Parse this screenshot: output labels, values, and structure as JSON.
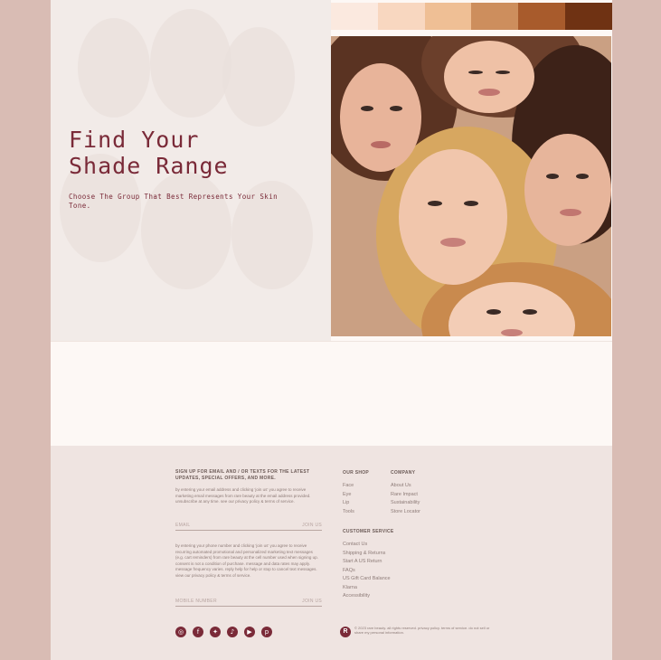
{
  "hero": {
    "title_line1": "Find Your",
    "title_line2": "Shade Range",
    "subtitle": "Choose The Group That Best Represents Your Skin Tone."
  },
  "swatches": [
    "#fbe9df",
    "#f8d7c0",
    "#efbf95",
    "#cd8e5d",
    "#a85b2c",
    "#6f3213"
  ],
  "footer": {
    "signup_heading": "SIGN UP FOR EMAIL AND / OR TEXTS FOR THE LATEST UPDATES, SPECIAL OFFERS, AND MORE.",
    "email_disclaimer": "by entering your email address and clicking 'join us' you agree to receive marketing email messages from rare beauty at the email address provided. unsubscribe at any time. see our privacy policy & terms of service.",
    "email_placeholder": "EMAIL",
    "email_join": "JOIN US",
    "sms_disclaimer": "by entering your phone number and clicking 'join us' you agree to receive recurring automated promotional and personalized marketing text messages (e.g. cart reminders) from rare beauty at the cell number used when signing up. consent is not a condition of purchase. message and data rates may apply. message frequency varies. reply help for help or stop to cancel text messages. view our privacy policy & terms of service.",
    "sms_placeholder": "MOBILE NUMBER",
    "sms_join": "JOIN US",
    "shop_heading": "OUR SHOP",
    "shop_links": [
      "Face",
      "Eye",
      "Lip",
      "Tools"
    ],
    "company_heading": "COMPANY",
    "company_links": [
      "About Us",
      "Rare Impact",
      "Sustainability",
      "Store Locator"
    ],
    "service_heading": "CUSTOMER SERVICE",
    "service_links": [
      "Contact Us",
      "Shipping & Returns",
      "Start A US Return",
      "FAQs",
      "US Gift Card Balance",
      "Klarna",
      "Accessibility"
    ],
    "social_icons": [
      "instagram-icon",
      "facebook-icon",
      "twitter-icon",
      "tiktok-icon",
      "youtube-icon",
      "pinterest-icon"
    ],
    "logo_letter": "R",
    "copyright": "© 2023 rare beauty. all rights reserved. privacy policy. terms of service. do not sell or share my personal information."
  }
}
